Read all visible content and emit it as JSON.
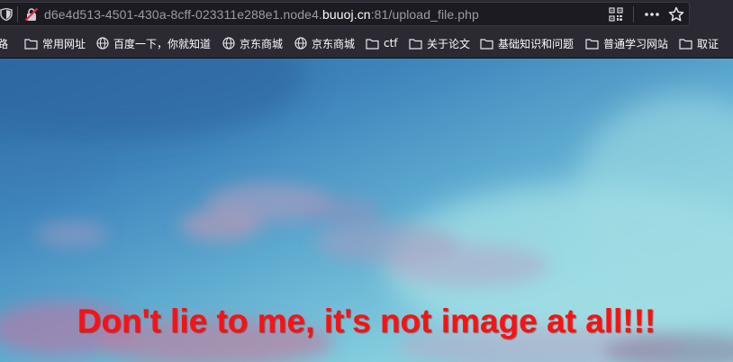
{
  "address_bar": {
    "url_prefix": "d6e4d513-4501-430a-8cff-023311e288e1.node4.",
    "url_host": "buuoj.cn",
    "url_suffix": ":81/upload_file.php"
  },
  "bookmarks": [
    {
      "label": "路",
      "icon": "none"
    },
    {
      "label": "常用网址",
      "icon": "folder-icon"
    },
    {
      "label": "百度一下，你就知道",
      "icon": "globe-icon"
    },
    {
      "label": "京东商城",
      "icon": "globe-icon"
    },
    {
      "label": "京东商城",
      "icon": "globe-icon"
    },
    {
      "label": "ctf",
      "icon": "folder-icon"
    },
    {
      "label": "关于论文",
      "icon": "folder-icon"
    },
    {
      "label": "基础知识和问题",
      "icon": "folder-icon"
    },
    {
      "label": "普通学习网站",
      "icon": "folder-icon"
    },
    {
      "label": "取证",
      "icon": "folder-icon"
    }
  ],
  "page": {
    "message": "Don't lie to me, it's not image at all!!!",
    "message_color": "#ff1010"
  },
  "colors": {
    "toolbar_bg": "#2b2a33",
    "urlbar_bg": "#1c1b22",
    "url_dim": "#9d9ca4",
    "url_bright": "#fbfbfe"
  }
}
